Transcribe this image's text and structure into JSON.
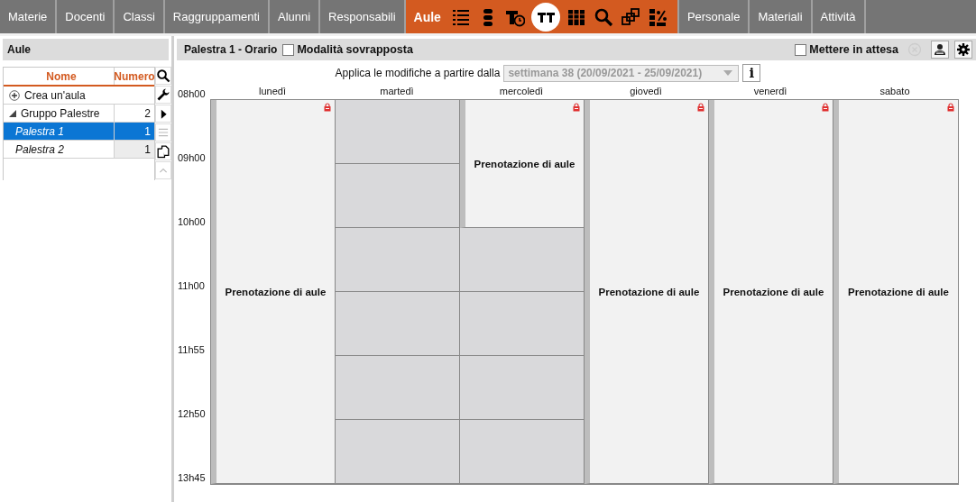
{
  "nav": {
    "tabs": [
      {
        "label": "Materie",
        "selected": false
      },
      {
        "label": "Docenti",
        "selected": false
      },
      {
        "label": "Classi",
        "selected": false
      },
      {
        "label": "Raggruppamenti",
        "selected": false
      },
      {
        "label": "Alunni",
        "selected": false
      },
      {
        "label": "Responsabili",
        "selected": false
      },
      {
        "label": "Aule",
        "selected": true,
        "tools": [
          {
            "kind": "list",
            "selected": false
          },
          {
            "kind": "stack",
            "selected": false
          },
          {
            "kind": "clock",
            "selected": false
          },
          {
            "kind": "timetable",
            "selected": true
          },
          {
            "kind": "grid",
            "selected": false
          },
          {
            "kind": "search",
            "selected": false
          },
          {
            "kind": "squares",
            "selected": false
          },
          {
            "kind": "percent",
            "selected": false
          }
        ]
      },
      {
        "label": "Personale",
        "selected": false
      },
      {
        "label": "Materiali",
        "selected": false
      },
      {
        "label": "Attività",
        "selected": false
      }
    ]
  },
  "sidebar": {
    "title": "Aule",
    "columns": [
      "Nome",
      "Numero"
    ],
    "create_label": "Crea un'aula",
    "groups": [
      {
        "name": "Gruppo Palestre",
        "count": "2",
        "expanded": true,
        "children": [
          {
            "name": "Palestra 1",
            "count": "1",
            "selected": true
          },
          {
            "name": "Palestra 2",
            "count": "1",
            "selected": false
          }
        ]
      }
    ],
    "tools": [
      {
        "kind": "search",
        "disabled": false
      },
      {
        "kind": "wrench",
        "disabled": false
      },
      {
        "kind": "play",
        "disabled": false
      },
      {
        "kind": "lines",
        "disabled": true
      },
      {
        "kind": "copy",
        "disabled": false
      },
      {
        "kind": "up",
        "disabled": true
      }
    ]
  },
  "main": {
    "title": "Palestra 1 - Orario",
    "overlay_mode": {
      "label": "Modalità sovrapposta",
      "checked": false
    },
    "hold": {
      "label": "Mettere in attesa",
      "checked": false
    },
    "apply_label": "Applica le modifiche a partire dalla",
    "week": "settimana 38 (20/09/2021 - 25/09/2021)",
    "info": "i",
    "times": [
      "08h00",
      "09h00",
      "10h00",
      "11h00",
      "11h55",
      "12h50",
      "13h45"
    ],
    "days": [
      {
        "label": "lunedì",
        "booking": {
          "text": "Prenotazione di aule",
          "locked": true
        },
        "slots": [
          {
            "kind": "booking"
          },
          {
            "kind": "booking"
          },
          {
            "kind": "booking"
          },
          {
            "kind": "booking"
          },
          {
            "kind": "booking"
          },
          {
            "kind": "booking"
          }
        ]
      },
      {
        "label": "martedì",
        "slots": [
          {
            "kind": "free"
          },
          {
            "kind": "free"
          },
          {
            "kind": "free"
          },
          {
            "kind": "free"
          },
          {
            "kind": "free"
          },
          {
            "kind": "free"
          }
        ]
      },
      {
        "label": "mercoledì",
        "booking": {
          "text": "Prenotazione di aule",
          "locked": true
        },
        "slots": [
          {
            "kind": "booking"
          },
          {
            "kind": "booking"
          },
          {
            "kind": "free"
          },
          {
            "kind": "free"
          },
          {
            "kind": "free"
          },
          {
            "kind": "free"
          }
        ]
      },
      {
        "label": "giovedì",
        "booking": {
          "text": "Prenotazione di aule",
          "locked": true
        },
        "slots": [
          {
            "kind": "booking"
          },
          {
            "kind": "booking"
          },
          {
            "kind": "booking"
          },
          {
            "kind": "booking"
          },
          {
            "kind": "booking"
          },
          {
            "kind": "booking"
          }
        ]
      },
      {
        "label": "venerdì",
        "booking": {
          "text": "Prenotazione di aule",
          "locked": true
        },
        "slots": [
          {
            "kind": "booking"
          },
          {
            "kind": "booking"
          },
          {
            "kind": "booking"
          },
          {
            "kind": "booking"
          },
          {
            "kind": "booking"
          },
          {
            "kind": "booking"
          }
        ]
      },
      {
        "label": "sabato",
        "booking": {
          "text": "Prenotazione di aule",
          "locked": true
        },
        "slots": [
          {
            "kind": "booking"
          },
          {
            "kind": "booking"
          },
          {
            "kind": "booking"
          },
          {
            "kind": "booking"
          },
          {
            "kind": "booking"
          },
          {
            "kind": "booking"
          }
        ]
      }
    ]
  }
}
